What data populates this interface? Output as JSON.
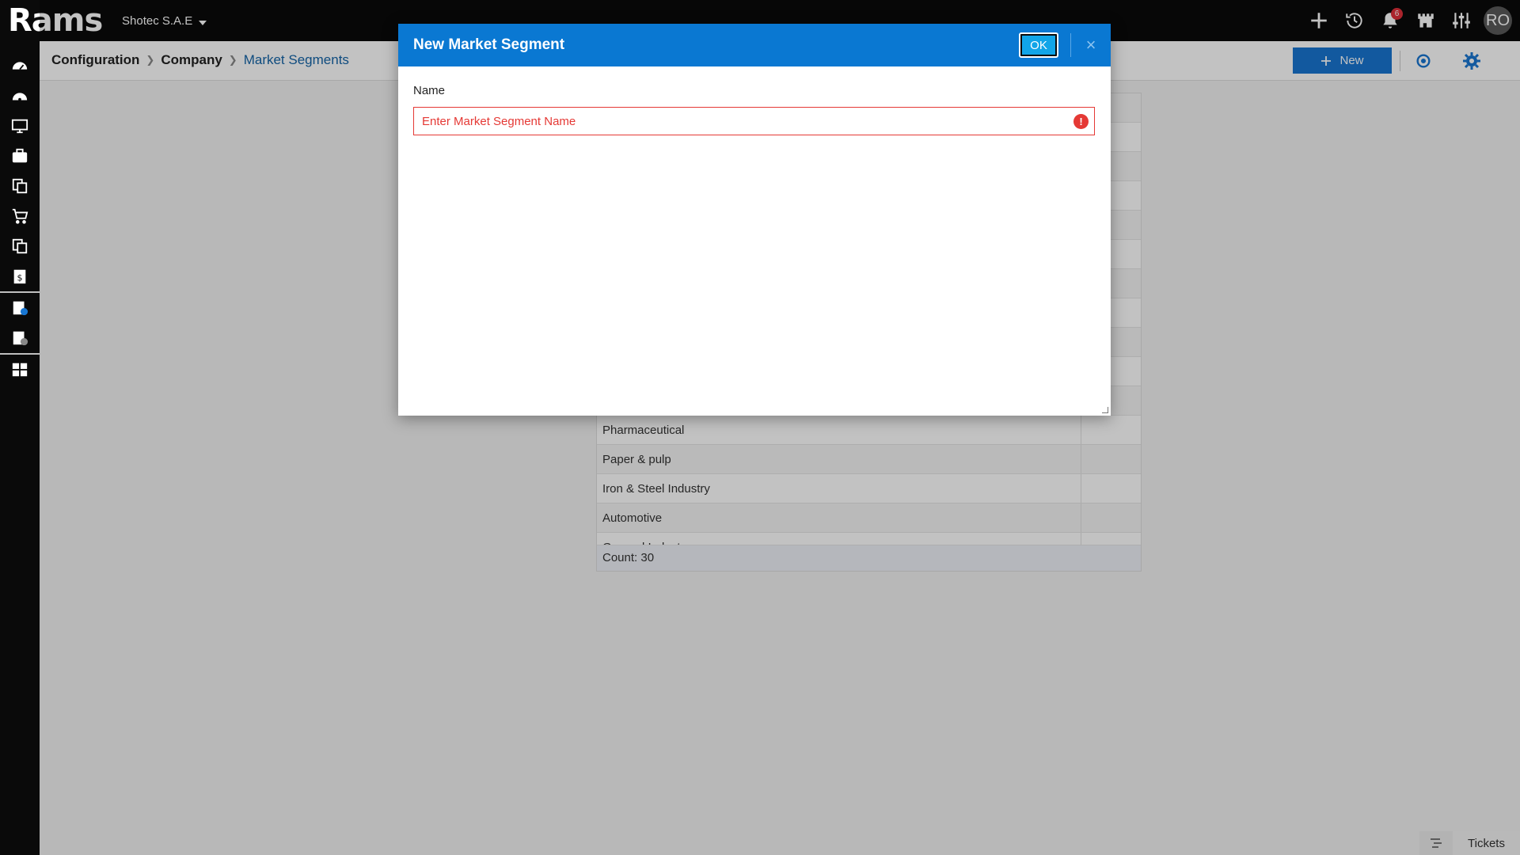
{
  "app": {
    "logo": "Rams",
    "company": "Shotec S.A.E"
  },
  "topbar": {
    "notification_count": "6",
    "avatar_initials": "RO"
  },
  "breadcrumb": [
    "Configuration",
    "Company",
    "Market Segments"
  ],
  "toolbar": {
    "new_label": "New"
  },
  "grid": {
    "rows": [
      "",
      "",
      "",
      "",
      "",
      "",
      "",
      "",
      "",
      "",
      "",
      "Pharmaceutical",
      "Paper & pulp",
      "Iron & Steel Industry",
      "Automotive"
    ],
    "partial_row": "General Industry",
    "count_label": "Count: 30"
  },
  "modal": {
    "title": "New Market Segment",
    "ok_label": "OK",
    "close_label": "×",
    "field_label": "Name",
    "field_placeholder": "Enter Market Segment Name",
    "field_value": "",
    "error_glyph": "!"
  },
  "tickets": {
    "label": "Tickets"
  },
  "icons": {
    "sidebar": [
      "dashboard-icon",
      "speedometer-icon",
      "monitor-icon",
      "briefcase-icon",
      "documents-icon",
      "cart-icon",
      "documents-icon",
      "invoice-icon",
      "approvals-icon",
      "settings-list-icon",
      "modules-icon"
    ],
    "topbar": [
      "plus-icon",
      "history-icon",
      "bell-icon",
      "castle-icon",
      "sliders-icon"
    ]
  },
  "colors": {
    "primary": "#1876d2",
    "modal_header": "#0a78d2",
    "error": "#e53935",
    "topbar": "#0a0a0a"
  }
}
